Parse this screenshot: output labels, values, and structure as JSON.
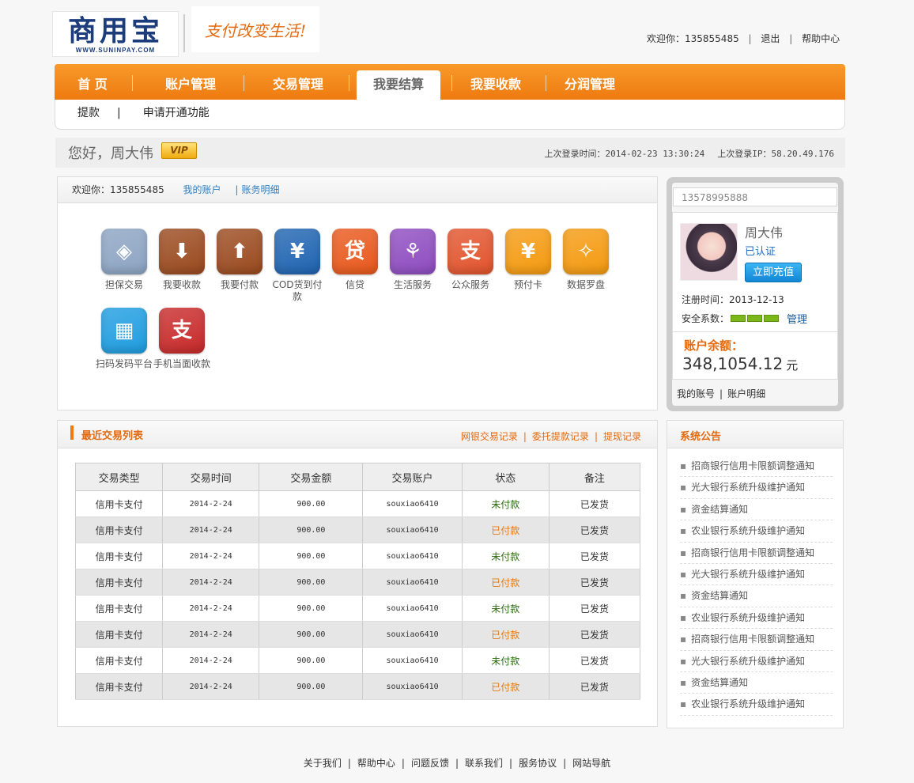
{
  "header": {
    "logo_text": "商用宝",
    "logo_sub": "WWW.SUNINPAY.COM",
    "slogan": "支付改变生活!",
    "welcome": "欢迎你：135855485",
    "logout": "退出",
    "help": "帮助中心"
  },
  "nav": {
    "items": [
      "首 页",
      "账户管理",
      "交易管理",
      "我要结算",
      "我要收款",
      "分润管理"
    ],
    "active": "我要结算"
  },
  "subnav": {
    "items": [
      "提款",
      "申请开通功能"
    ],
    "separator": "|"
  },
  "greeting": {
    "name": "您好，周大伟",
    "badge": "VIP",
    "last_login_time": "上次登录时间：2014-02-23 13:30:24",
    "last_login_ip": "上次登录IP：58.20.49.176"
  },
  "quick": {
    "welcome": "欢迎你：135855485",
    "link_account": "我的账户",
    "link_detail": "账务明细",
    "bar": "|",
    "icons": [
      {
        "label": "担保交易",
        "icon": "shield-icon",
        "color": "#8da4c3",
        "glyph": "◈"
      },
      {
        "label": "我要收款",
        "icon": "wallet-in-icon",
        "color": "#9a4a1e",
        "glyph": "⬇"
      },
      {
        "label": "我要付款",
        "icon": "wallet-out-icon",
        "color": "#9a4a1e",
        "glyph": "⬆"
      },
      {
        "label": "COD货到付款",
        "icon": "cart-icon",
        "color": "#1f64b1",
        "glyph": "¥"
      },
      {
        "label": "信贷",
        "icon": "loan-icon",
        "color": "#e8581c",
        "glyph": "贷"
      },
      {
        "label": "生活服务",
        "icon": "life-service-icon",
        "color": "#8e4cc0",
        "glyph": "⚘"
      },
      {
        "label": "公众服务",
        "icon": "public-service-icon",
        "color": "#e2542d",
        "glyph": "支"
      },
      {
        "label": "预付卡",
        "icon": "prepaid-card-icon",
        "color": "#f49a10",
        "glyph": "¥"
      },
      {
        "label": "数据罗盘",
        "icon": "compass-icon",
        "color": "#f49a10",
        "glyph": "✧"
      },
      {
        "label": "扫码发码平台",
        "icon": "qrcode-icon",
        "color": "#1f9de0",
        "glyph": "▦"
      },
      {
        "label": "手机当面收款",
        "icon": "mobile-pay-icon",
        "color": "#c82a2a",
        "glyph": "支"
      }
    ]
  },
  "account": {
    "phone": "13578995888",
    "name": "周大伟",
    "verified": "已认证",
    "topup": "立即充值",
    "register_date": "注册时间：2013-12-13",
    "security_label": "安全系数：",
    "security_level": 3,
    "manage": "管理",
    "balance_label": "账户余额：",
    "balance": "348,1054.12",
    "balance_unit": "元",
    "footer_account": "我的账号",
    "footer_detail": "账户明细",
    "footer_sep": "|"
  },
  "transactions": {
    "title": "最近交易列表",
    "links": [
      "网银交易记录",
      "委托提款记录",
      "提现记录"
    ],
    "columns": [
      "交易类型",
      "交易时间",
      "交易金额",
      "交易账户",
      "状态",
      "备注"
    ],
    "rows": [
      [
        "信用卡支付",
        "2014-2-24",
        "900.00",
        "souxiao6410",
        "未付款",
        "已发货"
      ],
      [
        "信用卡支付",
        "2014-2-24",
        "900.00",
        "souxiao6410",
        "已付款",
        "已发货"
      ],
      [
        "信用卡支付",
        "2014-2-24",
        "900.00",
        "souxiao6410",
        "未付款",
        "已发货"
      ],
      [
        "信用卡支付",
        "2014-2-24",
        "900.00",
        "souxiao6410",
        "已付款",
        "已发货"
      ],
      [
        "信用卡支付",
        "2014-2-24",
        "900.00",
        "souxiao6410",
        "未付款",
        "已发货"
      ],
      [
        "信用卡支付",
        "2014-2-24",
        "900.00",
        "souxiao6410",
        "已付款",
        "已发货"
      ],
      [
        "信用卡支付",
        "2014-2-24",
        "900.00",
        "souxiao6410",
        "未付款",
        "已发货"
      ],
      [
        "信用卡支付",
        "2014-2-24",
        "900.00",
        "souxiao6410",
        "已付款",
        "已发货"
      ]
    ]
  },
  "notices": {
    "title": "系统公告",
    "items": [
      "招商银行信用卡限额调整通知",
      "光大银行系统升级维护通知",
      "资金结算通知",
      "农业银行系统升级维护通知",
      "招商银行信用卡限额调整通知",
      "光大银行系统升级维护通知",
      "资金结算通知",
      "农业银行系统升级维护通知",
      "招商银行信用卡限额调整通知",
      "光大银行系统升级维护通知",
      "资金结算通知",
      "农业银行系统升级维护通知"
    ]
  },
  "footer": {
    "links": [
      "关于我们",
      "帮助中心",
      "问题反馈",
      "联系我们",
      "服务协议",
      "网站导航"
    ],
    "sep": "|"
  },
  "colors": {
    "accent": "#ee7a10",
    "link": "#2f7fbf",
    "unpaid": "#2b6b0e",
    "paid": "#e37a14"
  }
}
